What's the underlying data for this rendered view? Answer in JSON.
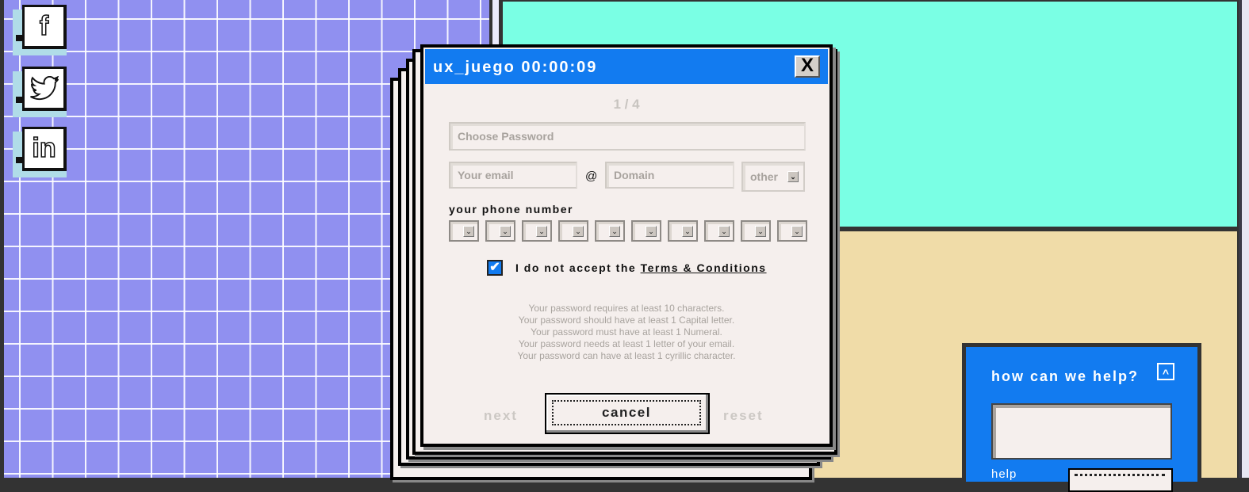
{
  "social": [
    {
      "name": "facebook",
      "icon": "facebook-icon",
      "glyph": "f"
    },
    {
      "name": "twitter",
      "icon": "twitter-icon",
      "glyph": "🐦"
    },
    {
      "name": "linkedin",
      "icon": "linkedin-icon",
      "glyph": "in"
    }
  ],
  "colors": {
    "grid_bg": "#9090f0",
    "mint": "#7affe4",
    "sand": "#f0dca8",
    "accent_blue": "#127bf0",
    "panel_bg": "#f5efed"
  },
  "dialog": {
    "title": "ux_juego 00:00:09",
    "close_glyph": "X",
    "step": "1 / 4",
    "password_placeholder": "Choose Password",
    "email_placeholder": "Your email",
    "at_sign": "@",
    "domain_placeholder": "Domain",
    "domain_select_value": "other",
    "phone_label": "your phone number",
    "phone_digit_count": 10,
    "terms_checked": true,
    "check_glyph": "✔",
    "terms_prefix": "I do not accept the",
    "terms_link": "Terms & Conditions",
    "rules": [
      "Your password requires at least 10 characters.",
      "Your password should have at least 1 Capital letter.",
      "Your password must have at least 1 Numeral.",
      "Your password needs at least 1 letter of your email.",
      "Your password can have at least 1 cyrillic character."
    ],
    "buttons": {
      "next": "next",
      "cancel": "cancel",
      "reset": "reset"
    }
  },
  "help": {
    "title": "how can we help?",
    "collapse_glyph": "^",
    "input_value": "",
    "label": "help"
  }
}
